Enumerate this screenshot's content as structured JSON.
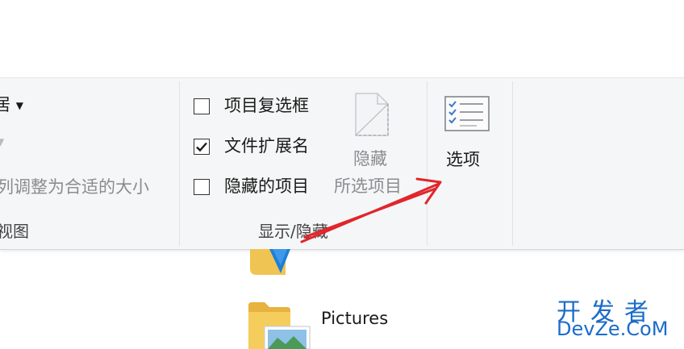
{
  "ribbon": {
    "layout_group": {
      "dropdown_label": "居",
      "size_columns_label": "列调整为合适的大小",
      "group_label": "视图"
    },
    "show_hide": {
      "checkboxes": [
        {
          "label": "项目复选框",
          "checked": false
        },
        {
          "label": "文件扩展名",
          "checked": true
        },
        {
          "label": "隐藏的项目",
          "checked": false
        }
      ],
      "hide_button_line1": "隐藏",
      "hide_button_line2": "所选项目",
      "group_label": "显示/隐藏"
    },
    "options": {
      "label": "选项"
    }
  },
  "files": [
    {
      "name": "Pictures",
      "icon": "pictures-folder-icon"
    }
  ],
  "watermark": {
    "line1": "开发者",
    "line2": "DevZe.CoM"
  },
  "colors": {
    "annotation_arrow": "#e0262b",
    "watermark": "#1b6cc8",
    "folder": "#f0c453"
  }
}
